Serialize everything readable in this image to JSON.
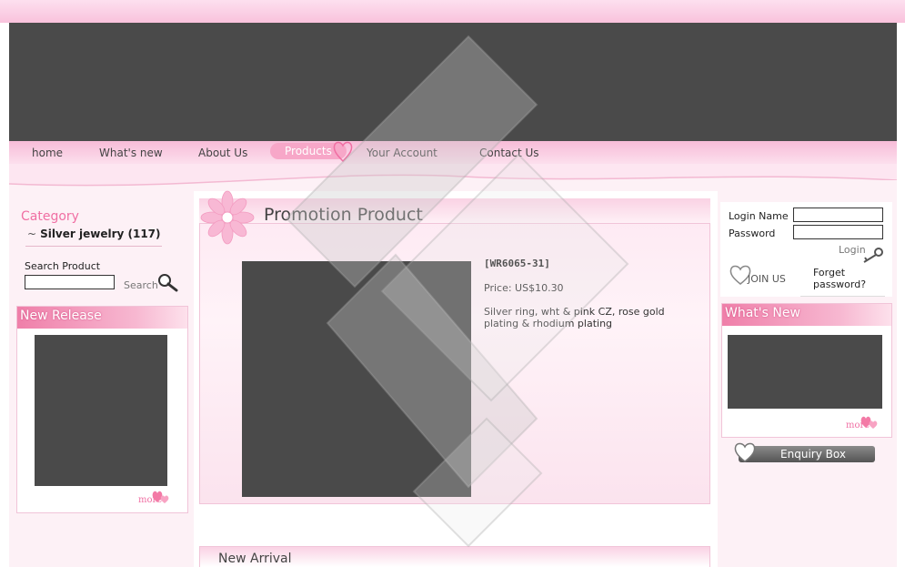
{
  "nav": {
    "items": [
      {
        "label": "home",
        "active": false
      },
      {
        "label": "What's new",
        "active": false
      },
      {
        "label": "About Us",
        "active": false
      },
      {
        "label": "Products",
        "active": true
      },
      {
        "label": "Your Account",
        "active": false
      },
      {
        "label": "Contact Us",
        "active": false
      }
    ]
  },
  "sidebar_left": {
    "category_title": "Category",
    "category_tilde": "~",
    "category_item": "Silver jewelry (117)",
    "search_label": "Search Product",
    "search_value": "",
    "search_button": "Search",
    "new_release_title": "New Release",
    "more_label": "more"
  },
  "promotion": {
    "title": "Promotion Product",
    "code": "[WR6065-31]",
    "price": "Price: US$10.30",
    "description": "Silver ring, wht & pink CZ, rose gold plating & rhodium plating"
  },
  "new_arrival": {
    "title": "New Arrival"
  },
  "sidebar_right": {
    "login_name_label": "Login Name",
    "password_label": "Password",
    "login_name_value": "",
    "password_value": "",
    "login_button": "Login",
    "join_label": "JOIN US",
    "forget_label": "Forget password?",
    "whats_new_title": "What's New",
    "more_label": "more",
    "enquiry_label": "Enquiry Box"
  },
  "colors": {
    "accent_pink": "#f06fa3",
    "placeholder_gray": "#4a4a4a",
    "nav_pink": "#f7bcd8"
  }
}
